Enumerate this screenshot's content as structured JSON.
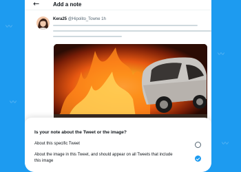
{
  "header": {
    "back_icon": "arrow-left-icon",
    "title": "Add a note"
  },
  "tweet": {
    "display_name": "Kera25",
    "handle": "@Hipolito_Towne",
    "time": "1h"
  },
  "sheet": {
    "question": "Is your note about the Tweet or the image?",
    "options": [
      {
        "label": "About this specific Tweet",
        "selected": false
      },
      {
        "label": "About the image in this Tweet, and should appear on all Tweets that include this image",
        "selected": true
      }
    ]
  },
  "colors": {
    "accent": "#1d9bf0",
    "text": "#0f1419",
    "muted": "#536471"
  }
}
